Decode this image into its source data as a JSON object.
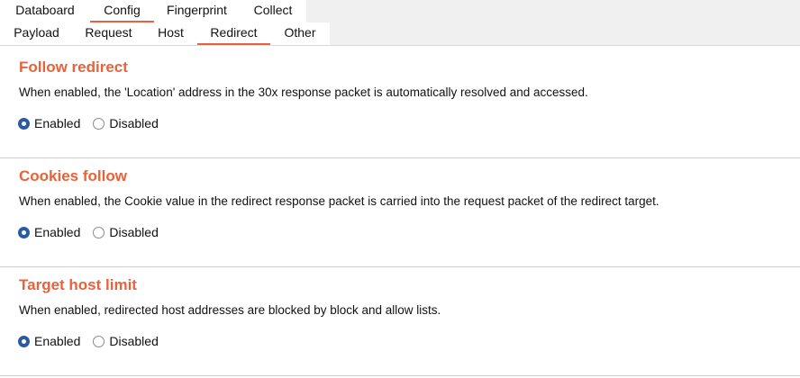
{
  "tabs": {
    "main": [
      {
        "label": "Databoard",
        "active": false
      },
      {
        "label": "Config",
        "active": true
      },
      {
        "label": "Fingerprint",
        "active": false
      },
      {
        "label": "Collect",
        "active": false
      }
    ],
    "sub": [
      {
        "label": "Payload",
        "active": false
      },
      {
        "label": "Request",
        "active": false
      },
      {
        "label": "Host",
        "active": false
      },
      {
        "label": "Redirect",
        "active": true
      },
      {
        "label": "Other",
        "active": false
      }
    ]
  },
  "sections": [
    {
      "title": "Follow redirect",
      "description": "When enabled, the 'Location' address in the 30x response packet is automatically resolved and accessed.",
      "options": [
        {
          "label": "Enabled",
          "checked": true
        },
        {
          "label": "Disabled",
          "checked": false
        }
      ]
    },
    {
      "title": "Cookies follow",
      "description": "When enabled, the Cookie value in the redirect response packet is carried into the request packet of the redirect target.",
      "options": [
        {
          "label": "Enabled",
          "checked": true
        },
        {
          "label": "Disabled",
          "checked": false
        }
      ]
    },
    {
      "title": "Target host limit",
      "description": "When enabled, redirected host addresses are blocked by block and allow lists.",
      "options": [
        {
          "label": "Enabled",
          "checked": true
        },
        {
          "label": "Disabled",
          "checked": false
        }
      ]
    }
  ],
  "colors": {
    "accent": "#e8623a",
    "radio_checked": "#2b5aa0"
  }
}
